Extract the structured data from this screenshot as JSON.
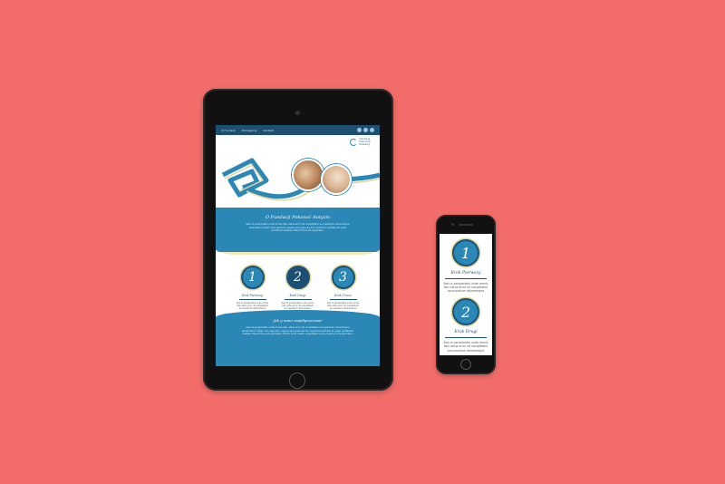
{
  "colors": {
    "background": "#f26d6a",
    "primary": "#2a87b6",
    "dark": "#1d4f73",
    "accent": "#e4d59a"
  },
  "tablet": {
    "nav": [
      "O Fundacji",
      "Pomagamy",
      "Kontakt"
    ],
    "social_icons": [
      "facebook-icon",
      "twitter-icon",
      "instagram-icon"
    ],
    "logo": [
      "Fundacja",
      "Pomocnik",
      "Ruszamy"
    ],
    "band": {
      "heading": "O Fundacji Pokonać Autyzm",
      "body": "Sed ut perspiciatis unde omnis iste natus error sit voluptatem accusantium doloremque laudantium totam rem aperiam eaque ipsa quae ab illo inventore veritatis et quasi architecto beatae vitae dicta sunt explicabo."
    },
    "steps": [
      {
        "number": "1",
        "title": "Krok Pierwszy",
        "desc": "Sed ut perspiciatis unde omnis iste natus error sit voluptatem accusantium doloremque"
      },
      {
        "number": "2",
        "title": "Krok Drugi",
        "desc": "Sed ut perspiciatis unde omnis iste natus error sit voluptatem accusantium doloremque"
      },
      {
        "number": "3",
        "title": "Krok Trzeci",
        "desc": "Sed ut perspiciatis unde omnis iste natus error sit voluptatem accusantium doloremque"
      }
    ],
    "footer": {
      "heading": "Jak y nami współpracować",
      "body": "Sed ut perspiciatis unde omnis iste natus error sit voluptatem accusantium doloremque laudantium, totam rem aperiam, eaque ipsa quae ab illo inventore veritatis et quasi architecto beatae vitae dicta sunt explicabo. Nemo enim ipsam voluptatem quia voluptas sit aspernatur."
    }
  },
  "phone": {
    "steps": [
      {
        "number": "1",
        "title": "Krok Pierwszy",
        "desc": "Sed ut perspiciatis unde omnis iste natus error sit voluptatem accusantium doloremque"
      },
      {
        "number": "2",
        "title": "Krok Drugi",
        "desc": "Sed ut perspiciatis unde omnis iste natus error sit voluptatem accusantium doloremque"
      }
    ]
  }
}
